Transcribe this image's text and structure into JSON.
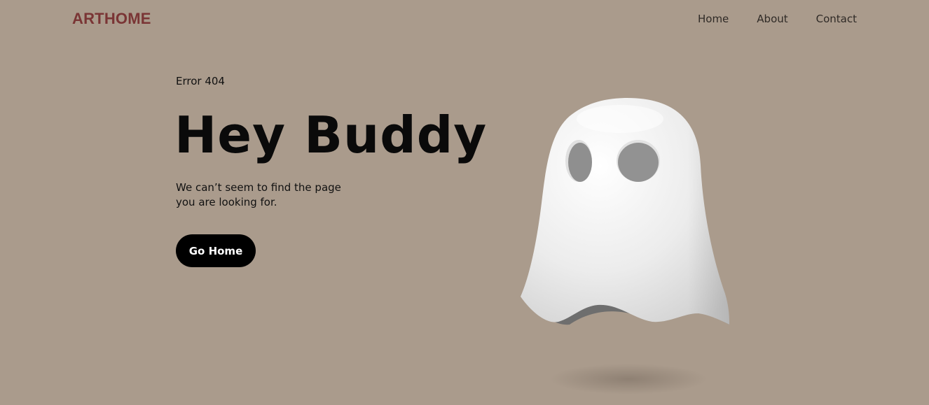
{
  "header": {
    "logo": "ARTHOME",
    "nav": [
      "Home",
      "About",
      "Contact"
    ]
  },
  "hero": {
    "error_label": "Error 404",
    "title": "Hey Buddy",
    "description_line1": "We can’t seem to find the page",
    "description_line2": "you are looking for.",
    "button_label": "Go Home"
  },
  "colors": {
    "background": "#aa9b8c",
    "logo": "#7a3535",
    "button": "#000000"
  },
  "icons": {
    "illustration": "ghost-illustration"
  }
}
